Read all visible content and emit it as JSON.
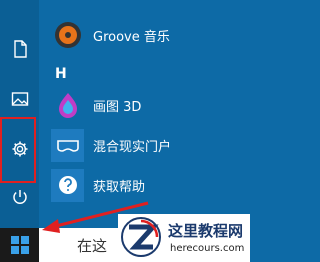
{
  "sections": [
    {
      "letter": "H"
    }
  ],
  "apps": [
    {
      "label": "Groove 音乐",
      "icon": "groove-music-icon"
    },
    {
      "label": "画图 3D",
      "icon": "paint-3d-icon"
    },
    {
      "label": "混合现实门户",
      "icon": "mixed-reality-portal-icon"
    },
    {
      "label": "获取帮助",
      "icon": "get-help-icon"
    }
  ],
  "rail": [
    "document-icon",
    "pictures-icon",
    "settings-icon",
    "power-icon"
  ],
  "taskbar": {
    "search_text": "在这"
  },
  "watermark": {
    "title": "这里教程网",
    "url": "herecours.com"
  },
  "colors": {
    "start_bg": "#0d6aa6",
    "rail_bg": "#0b5f95",
    "highlight": "#e02020",
    "tile": "#1e7bbf"
  }
}
